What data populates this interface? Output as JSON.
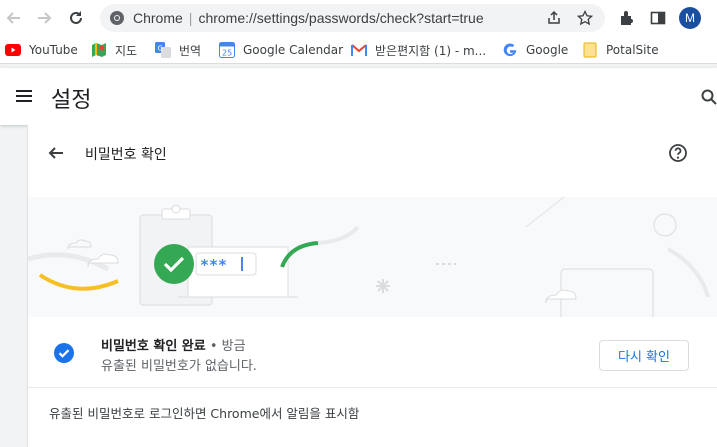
{
  "browser": {
    "omnibox": {
      "site_label": "Chrome",
      "separator": "|",
      "url": "chrome://settings/passwords/check?start=true"
    },
    "profile_initial": "M"
  },
  "bookmarks": [
    {
      "label": "YouTube",
      "icon": "youtube-icon"
    },
    {
      "label": "지도",
      "icon": "maps-icon"
    },
    {
      "label": "번역",
      "icon": "translate-icon"
    },
    {
      "label": "Google Calendar",
      "icon": "calendar-icon"
    },
    {
      "label": "받은편지함 (1) - m...",
      "icon": "gmail-icon"
    },
    {
      "label": "Google",
      "icon": "google-icon"
    },
    {
      "label": "PotalSite",
      "icon": "folder-icon"
    }
  ],
  "settings": {
    "title": "설정"
  },
  "password_check": {
    "title": "비밀번호 확인",
    "status_title": "비밀번호 확인 완료",
    "status_sep": " • ",
    "status_time": "방금",
    "status_detail": "유출된 비밀번호가 없습니다.",
    "recheck_label": "다시 확인",
    "notice": "유출된 비밀번호로 로그인하면 Chrome에서 알림을 표시함",
    "illustration_masked_password": "***"
  },
  "colors": {
    "accent": "#1a73e8",
    "success": "#34a853",
    "warning": "#f6bf26"
  }
}
